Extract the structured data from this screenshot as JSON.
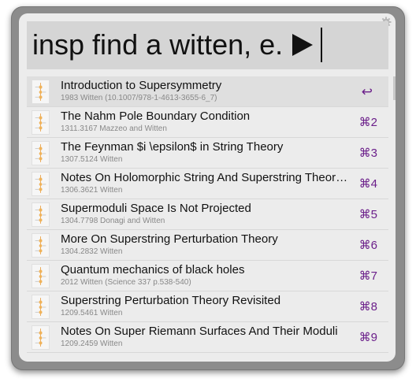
{
  "query": {
    "text": "insp find a witten, e."
  },
  "results": [
    {
      "title": "Introduction to Supersymmetry",
      "subtitle": "1983 Witten (10.1007/978-1-4613-3655-6_7)",
      "shortcut": "↩"
    },
    {
      "title": "The Nahm Pole Boundary Condition",
      "subtitle": "1311.3167 Mazzeo and Witten",
      "shortcut": "⌘2"
    },
    {
      "title": "The Feynman $i \\epsilon$ in String Theory",
      "subtitle": "1307.5124 Witten",
      "shortcut": "⌘3"
    },
    {
      "title": "Notes On Holomorphic String And Superstring Theory Measures Of Low Genus",
      "subtitle": "1306.3621 Witten",
      "shortcut": "⌘4"
    },
    {
      "title": "Supermoduli Space Is Not Projected",
      "subtitle": "1304.7798 Donagi and Witten",
      "shortcut": "⌘5"
    },
    {
      "title": "More On Superstring Perturbation Theory",
      "subtitle": "1304.2832 Witten",
      "shortcut": "⌘6"
    },
    {
      "title": "Quantum mechanics of black holes",
      "subtitle": "2012 Witten (Science 337 p.538-540)",
      "shortcut": "⌘7"
    },
    {
      "title": "Superstring Perturbation Theory Revisited",
      "subtitle": "1209.5461 Witten",
      "shortcut": "⌘8"
    },
    {
      "title": "Notes On Super Riemann Surfaces And Their Moduli",
      "subtitle": "1209.2459 Witten",
      "shortcut": "⌘9"
    }
  ],
  "colors": {
    "shortcut": "#6b1f8a",
    "frame": "#8c8c8c",
    "panel": "#ececec",
    "query_bg": "#d5d5d5"
  },
  "icons": {
    "result_thumb": "document-thumbnail-icon",
    "settings": "gear-icon",
    "run": "play-icon"
  }
}
